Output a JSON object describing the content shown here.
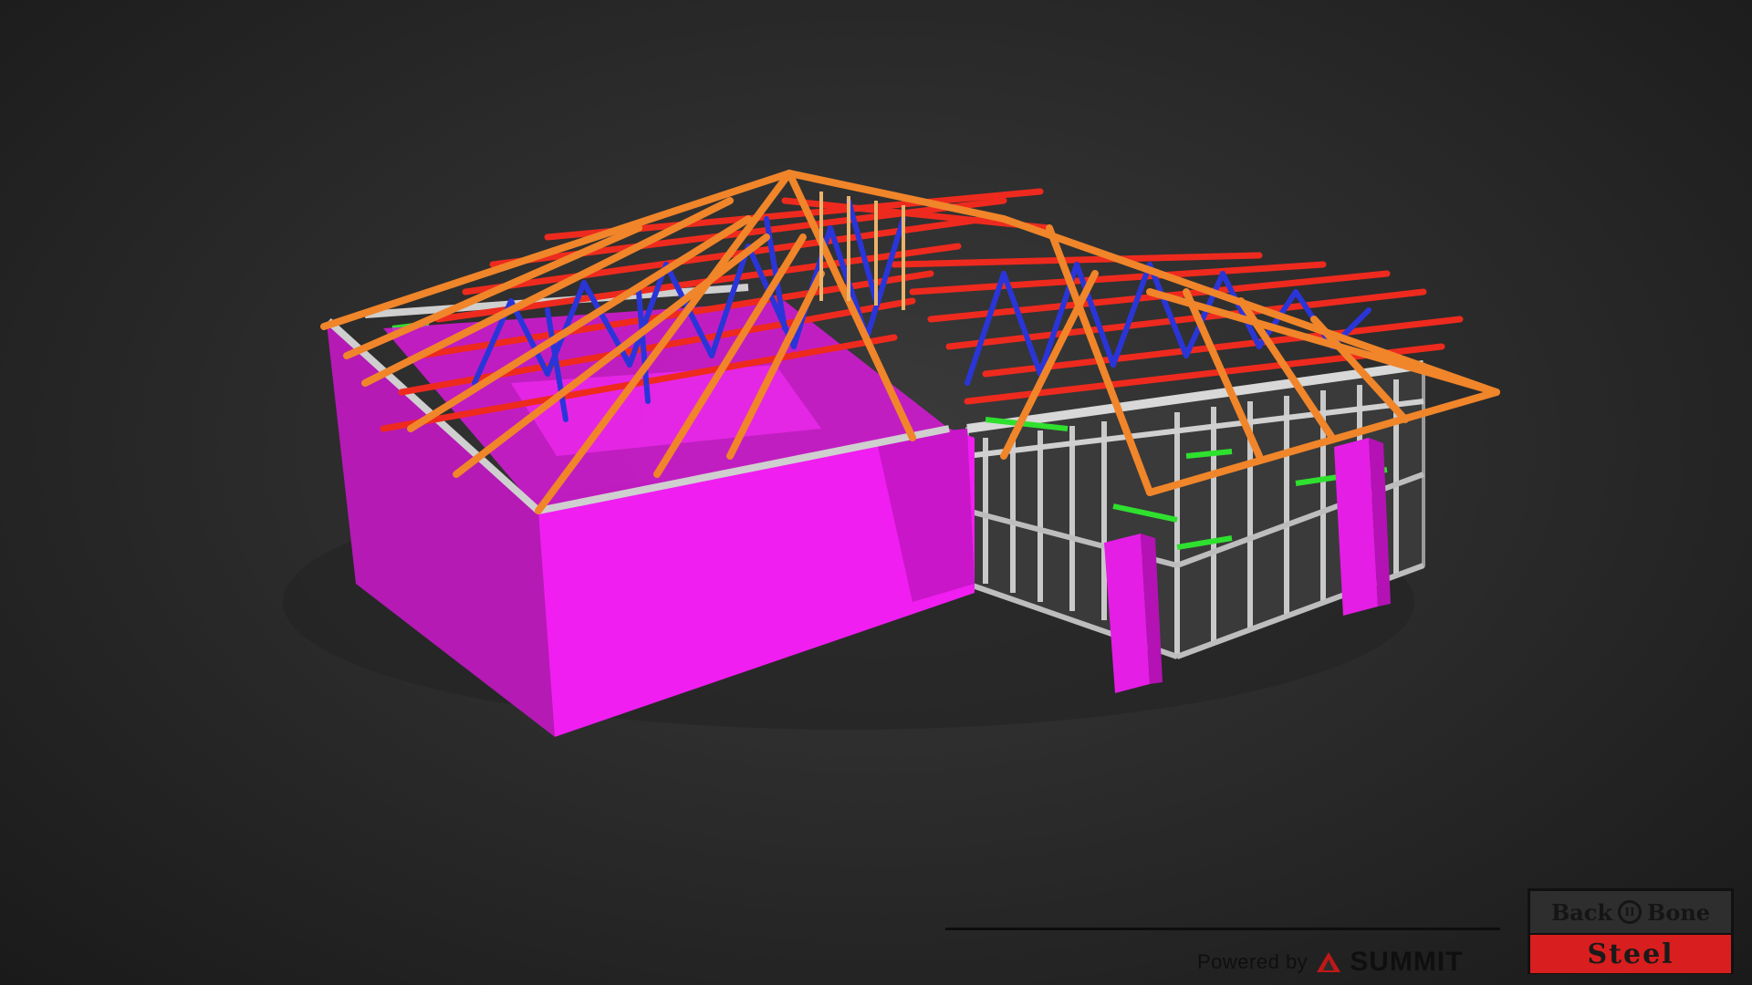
{
  "viewer": {
    "colors": {
      "background": "#2c2c2c",
      "wall_cladding": "#f21cf2",
      "roof_rafters": "#f0852a",
      "truss_chords": "#ee2a1e",
      "truss_webs": "#2a35d8",
      "wall_frames": "#c8c8c8",
      "nogging": "#2fe02f"
    }
  },
  "footer": {
    "powered_by": "Powered by",
    "brand": "SUMMIT",
    "brand_icon": "summit-logo-icon"
  },
  "logo": {
    "top_left": "Back",
    "ring_mark": "II",
    "top_right": "Bone",
    "bottom": "Steel"
  }
}
